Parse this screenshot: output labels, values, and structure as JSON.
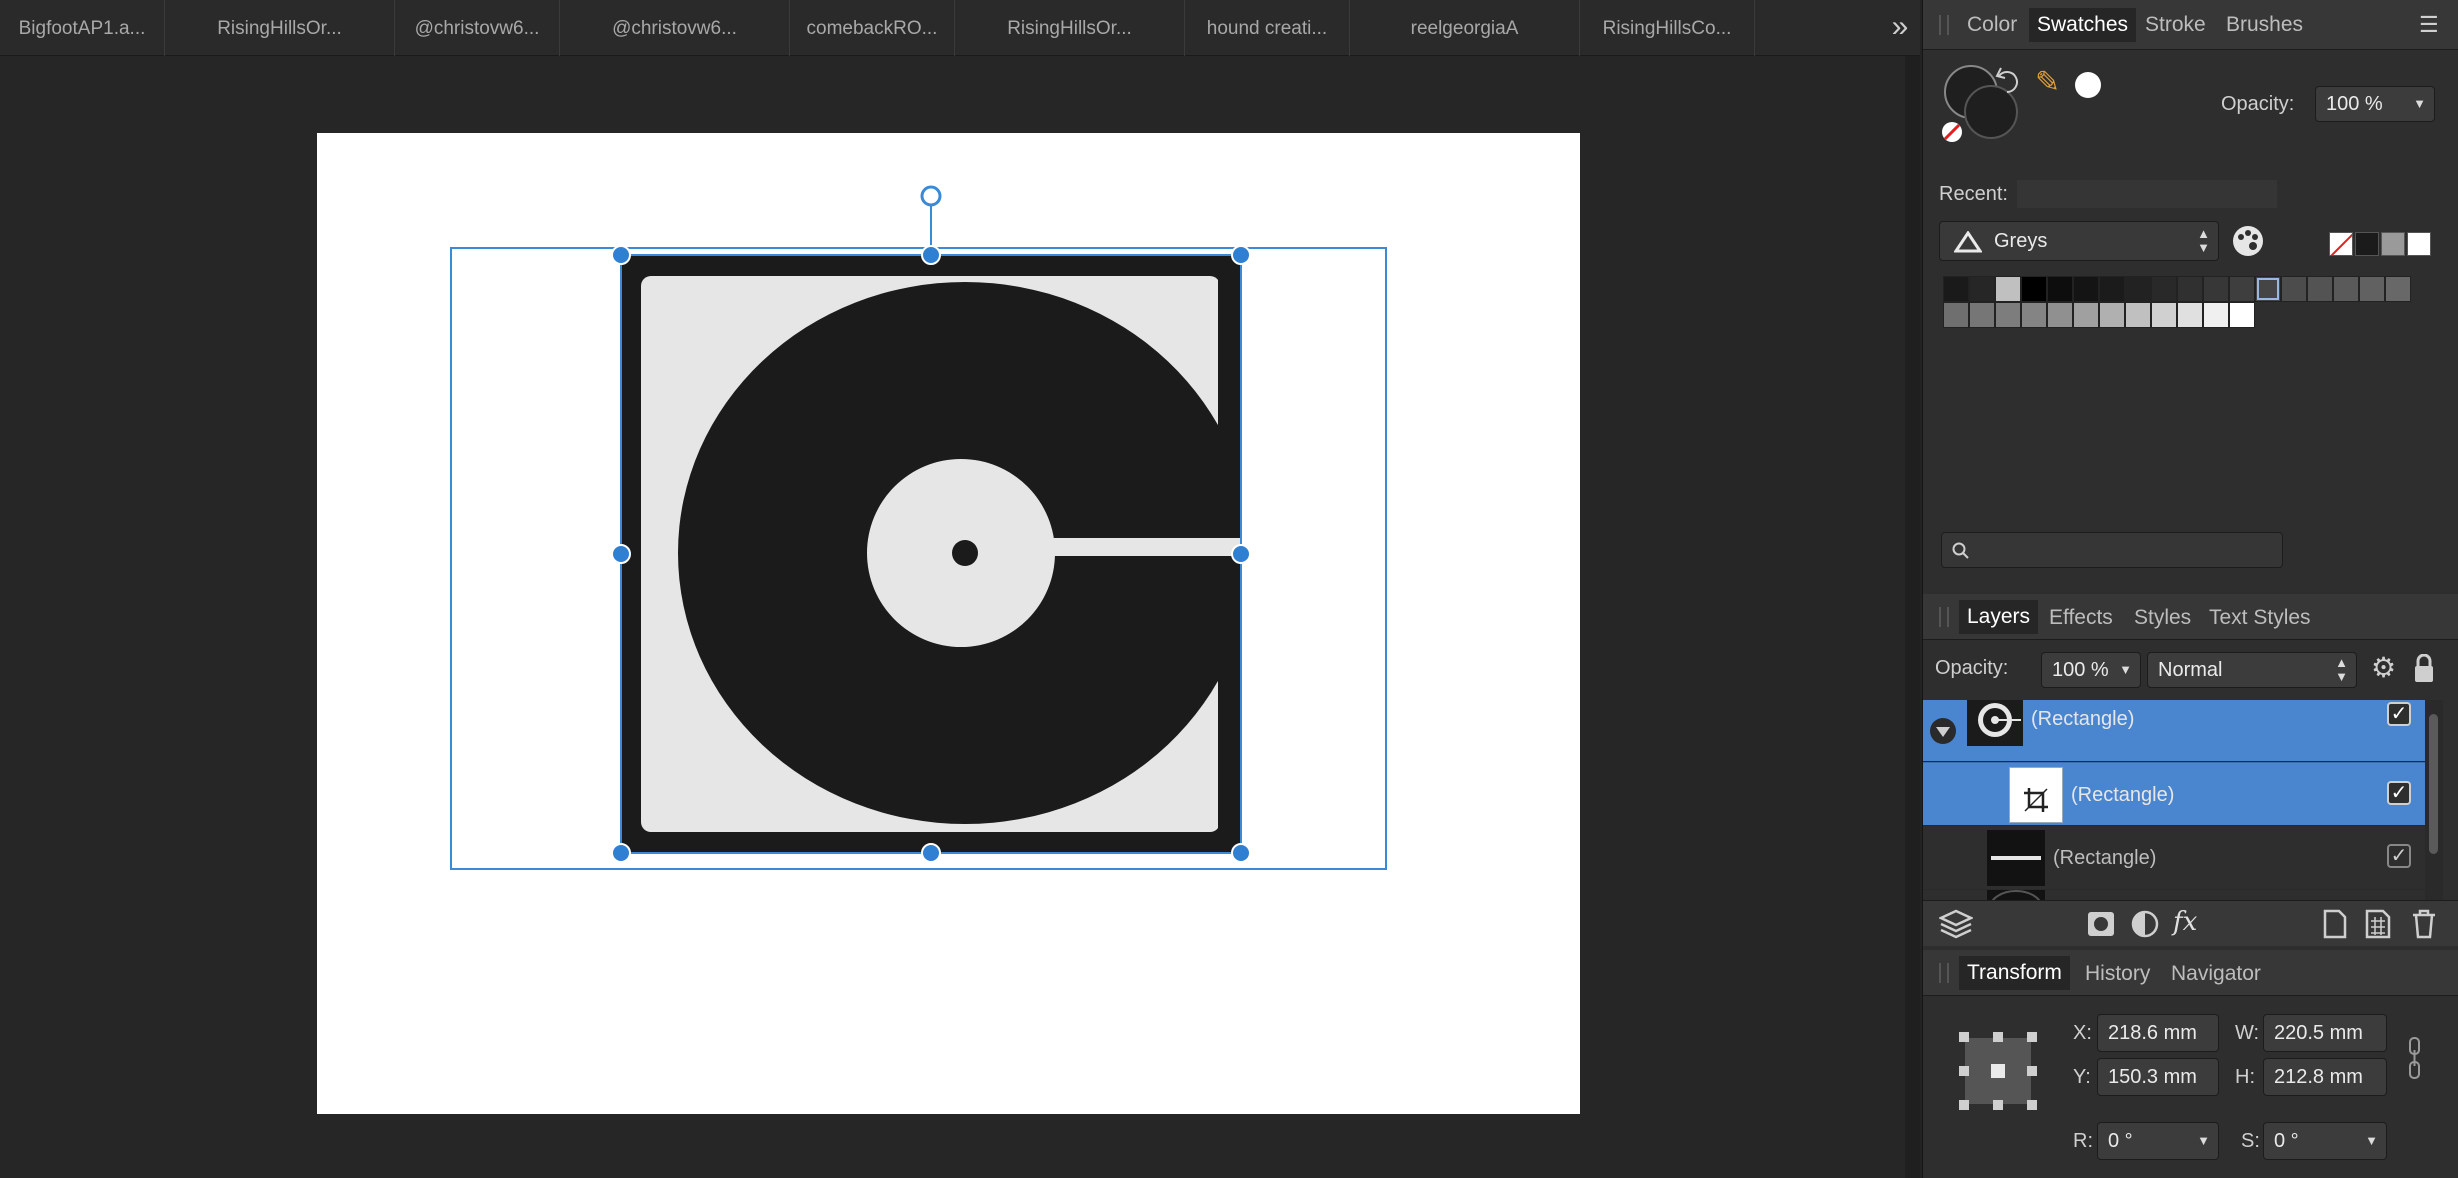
{
  "document_tabs": [
    "BigfootAP1.a...",
    "RisingHillsOr...",
    "@christovw6...",
    "@christovw6...",
    "comebackRO...",
    "RisingHillsOr...",
    "hound creati...",
    "reelgeorgiaA",
    "RisingHillsCo..."
  ],
  "tabs_overflow_icon": "chevron-double-right-icon",
  "color_panel": {
    "tabs": [
      "Color",
      "Swatches",
      "Stroke",
      "Brushes"
    ],
    "active_tab": "Swatches",
    "opacity_label": "Opacity:",
    "opacity_value": "100 %",
    "recent_label": "Recent:",
    "palette_name": "Greys",
    "search_placeholder": "",
    "fill_color": "#1f1f1f",
    "stroke_color": "#1f1f1f",
    "picked_color": "#ffffff",
    "recent_swatches": [
      "none",
      "#1b1b1b",
      "#9a9a9a",
      "#ffffff"
    ],
    "grey_swatches": [
      "#1a1a1a",
      "#262626",
      "#c0c0c0",
      "#000000",
      "#0d0d0d",
      "#141414",
      "#1b1b1b",
      "#222222",
      "#292929",
      "#303030",
      "#373737",
      "#3e3e3e",
      "#454545",
      "#4c4c4c",
      "#535353",
      "#5a5a5a",
      "#616161",
      "#686868",
      "#6f6f6f",
      "#767676",
      "#7d7d7d",
      "#848484",
      "#909090",
      "#a0a0a0",
      "#b0b0b0",
      "#c0c0c0",
      "#d0d0d0",
      "#e0e0e0",
      "#f0f0f0",
      "#ffffff"
    ],
    "selected_swatch_index": 12
  },
  "layers_panel": {
    "tabs": [
      "Layers",
      "Effects",
      "Styles",
      "Text Styles"
    ],
    "active_tab": "Layers",
    "opacity_label": "Opacity:",
    "opacity_value": "100 %",
    "blend_mode": "Normal",
    "layers": [
      {
        "name": "(Rectangle)",
        "selected": true,
        "expanded": true,
        "visible": true
      },
      {
        "name": "(Rectangle)",
        "selected": true,
        "child": true,
        "visible": true
      },
      {
        "name": "(Rectangle)",
        "selected": false,
        "visible": true
      }
    ]
  },
  "transform_panel": {
    "tabs": [
      "Transform",
      "History",
      "Navigator"
    ],
    "active_tab": "Transform",
    "x_label": "X:",
    "x_value": "218.6 mm",
    "y_label": "Y:",
    "y_value": "150.3 mm",
    "w_label": "W:",
    "w_value": "220.5 mm",
    "h_label": "H:",
    "h_value": "212.8 mm",
    "r_label": "R:",
    "r_value": "0 °",
    "s_label": "S:",
    "s_value": "0 °"
  },
  "colors": {
    "selection_blue": "#3b8ad8",
    "logo_black": "#1b1b1b",
    "logo_light": "#e6e6e6"
  }
}
